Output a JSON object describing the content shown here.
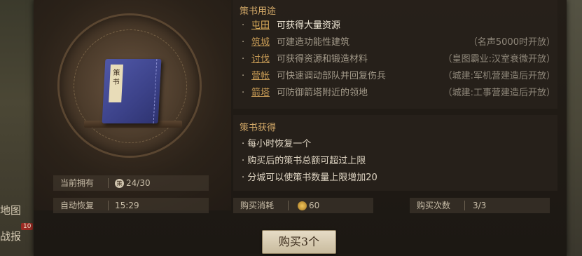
{
  "map": {
    "left_label_1": "地图",
    "left_label_2": "战报"
  },
  "book": {
    "label": "策书"
  },
  "usage": {
    "title": "策书用途",
    "items": [
      {
        "name": "屯田",
        "desc": "可获得大量资源",
        "condition": ""
      },
      {
        "name": "筑城",
        "desc": "可建造功能性建筑",
        "condition": "（名声5000时开放）"
      },
      {
        "name": "讨伐",
        "desc": "可获得资源和锻造材料",
        "condition": "（皇图霸业:汉室衰微开放）"
      },
      {
        "name": "营帐",
        "desc": "可快速调动部队并回复伤兵",
        "condition": "（城建:军机营建造后开放）"
      },
      {
        "name": "箭塔",
        "desc": "可防御箭塔附近的领地",
        "condition": "（城建:工事营建造后开放）"
      }
    ]
  },
  "obtain": {
    "title": "策书获得",
    "items": [
      "每小时恢复一个",
      "购买后的策书总额可超过上限",
      "分城可以使策书数量上限增加20"
    ]
  },
  "stats": {
    "owned_label": "当前拥有",
    "owned_icon": "策",
    "owned_value": "24/30",
    "recover_label": "自动恢复",
    "recover_value": "15:29",
    "cost_label": "购买消耗",
    "cost_value": "60",
    "times_label": "购买次数",
    "times_value": "3/3"
  },
  "buy_button": "购买3个"
}
